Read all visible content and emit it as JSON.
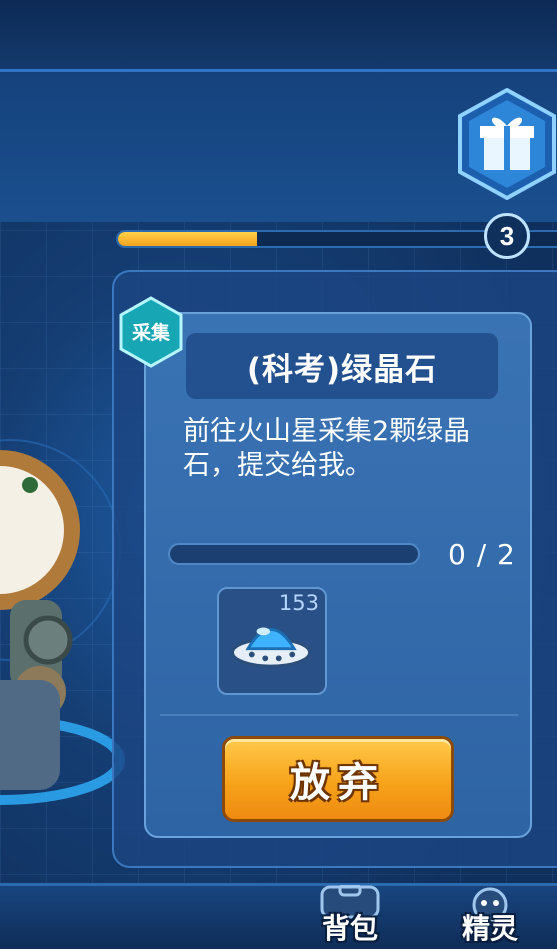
{
  "progress": {
    "fill": 0.36,
    "level": "3"
  },
  "quest": {
    "tag": "采集",
    "title": "(科考)绿晶石",
    "description": "前往火山星采集2颗绿晶石，提交给我。",
    "progress_text": "0 / 2",
    "progress_fill": 0,
    "reward_count": "153",
    "reward_icon": "ufo-icon",
    "abandon_label": "放弃"
  },
  "bottom_nav": {
    "backpack_label": "背包",
    "sprite_label": "精灵"
  },
  "colors": {
    "accent_orange": "#f7a31b",
    "progress_yellow": "#ffd24a",
    "panel_blue": "#2e64a4",
    "badge_teal": "#1fc9c9"
  }
}
